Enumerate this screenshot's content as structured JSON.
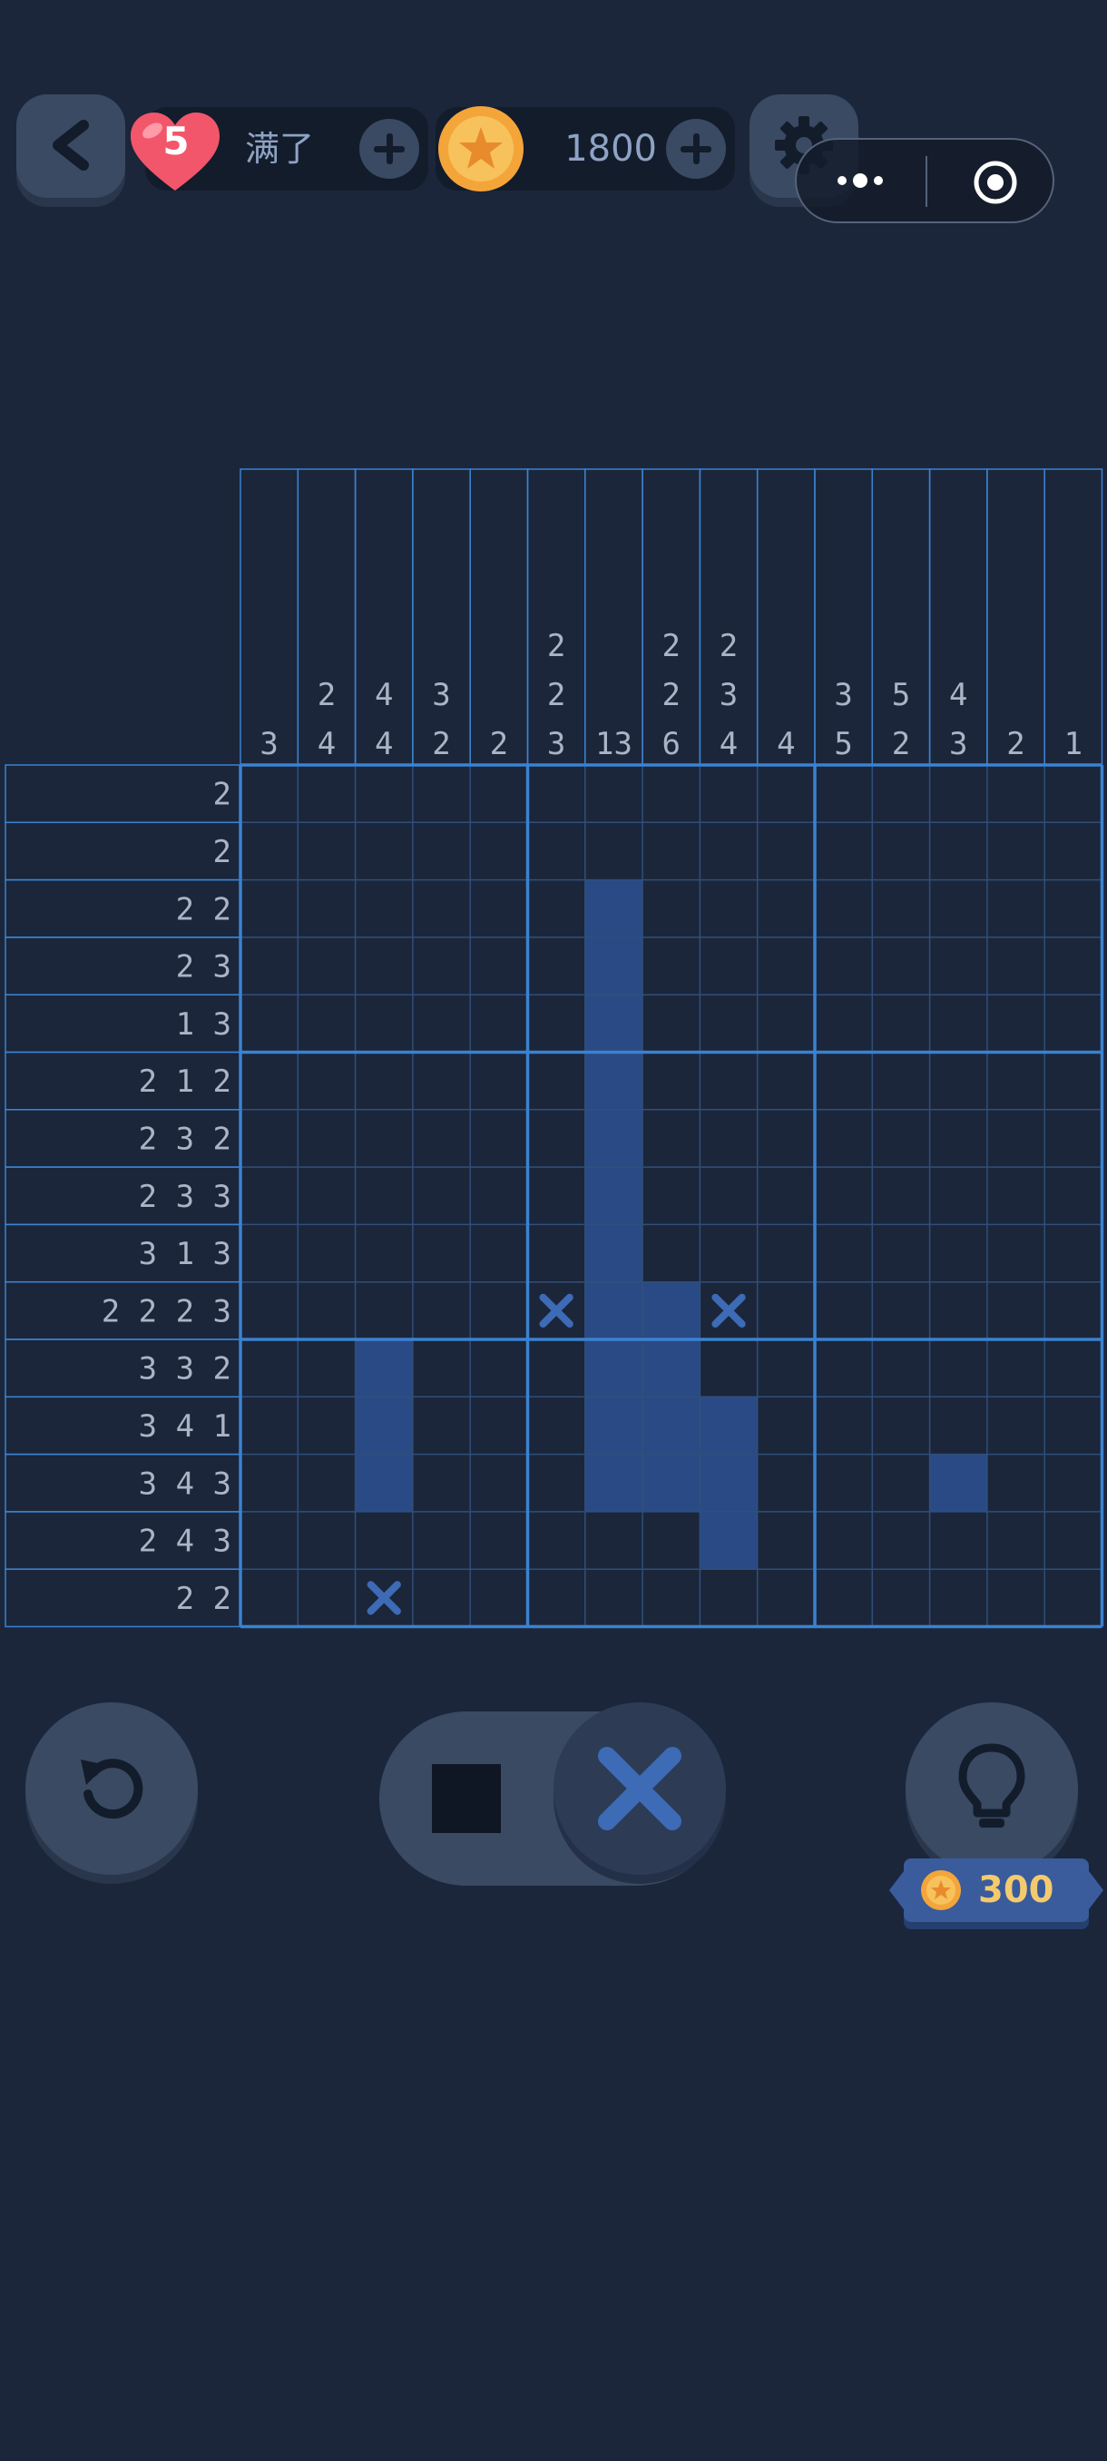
{
  "header": {
    "back_icon": "chevron-left-icon",
    "lives": "5",
    "lives_status": "满了",
    "coins": "1800",
    "settings_icon": "gear-icon"
  },
  "capsule": {
    "menu_icon": "more-dots-icon",
    "close_icon": "target-circle-icon"
  },
  "puzzle": {
    "size": 15,
    "column_clues": [
      [
        "3"
      ],
      [
        "2",
        "4"
      ],
      [
        "4",
        "4"
      ],
      [
        "3",
        "2"
      ],
      [
        "2"
      ],
      [
        "2",
        "2",
        "3"
      ],
      [
        "13"
      ],
      [
        "2",
        "2",
        "6"
      ],
      [
        "2",
        "3",
        "4"
      ],
      [
        "4"
      ],
      [
        "3",
        "5"
      ],
      [
        "5",
        "2"
      ],
      [
        "4",
        "3"
      ],
      [
        "2"
      ],
      [
        "1"
      ]
    ],
    "row_clues": [
      "2",
      "2",
      "2 2",
      "2 3",
      "1 3",
      "2 1 2",
      "2 3 2",
      "2 3 3",
      "3 1 3",
      "2 2 2 3",
      "3 3 2",
      "3 4 1",
      "3 4 3",
      "2 4 3",
      "2 2"
    ],
    "filled_cells": [
      [
        2,
        6
      ],
      [
        3,
        6
      ],
      [
        4,
        6
      ],
      [
        5,
        6
      ],
      [
        6,
        6
      ],
      [
        7,
        6
      ],
      [
        8,
        6
      ],
      [
        9,
        6
      ],
      [
        9,
        7
      ],
      [
        10,
        2
      ],
      [
        10,
        6
      ],
      [
        10,
        7
      ],
      [
        11,
        2
      ],
      [
        11,
        6
      ],
      [
        11,
        7
      ],
      [
        11,
        8
      ],
      [
        12,
        2
      ],
      [
        12,
        6
      ],
      [
        12,
        7
      ],
      [
        12,
        8
      ],
      [
        12,
        12
      ],
      [
        13,
        8
      ]
    ],
    "crossed_cells": [
      [
        9,
        5
      ],
      [
        9,
        8
      ],
      [
        14,
        2
      ]
    ],
    "colors": {
      "background": "#1b263a",
      "cell_line": "#2f4f7a",
      "block_line": "#3b82d0",
      "filled": "#2a4a86",
      "cross": "#3d6bb5",
      "clue_text": "#a9b4c6"
    }
  },
  "controls": {
    "undo_icon": "undo-icon",
    "fill_mode_icon": "filled-square-icon",
    "cross_mode_icon": "cross-icon",
    "active_mode": "cross",
    "hint_icon": "lightbulb-icon",
    "hint_cost": "300"
  }
}
